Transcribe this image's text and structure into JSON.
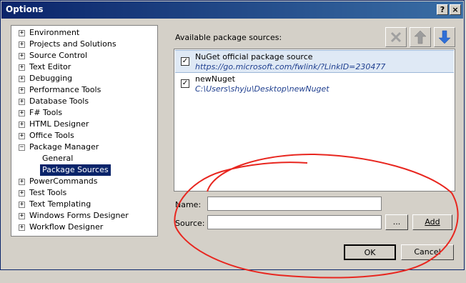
{
  "window": {
    "title": "Options",
    "help_btn": "?",
    "close_btn": "×"
  },
  "tree": {
    "items": [
      {
        "label": "Environment",
        "expander": "+"
      },
      {
        "label": "Projects and Solutions",
        "expander": "+"
      },
      {
        "label": "Source Control",
        "expander": "+"
      },
      {
        "label": "Text Editor",
        "expander": "+"
      },
      {
        "label": "Debugging",
        "expander": "+"
      },
      {
        "label": "Performance Tools",
        "expander": "+"
      },
      {
        "label": "Database Tools",
        "expander": "+"
      },
      {
        "label": "F# Tools",
        "expander": "+"
      },
      {
        "label": "HTML Designer",
        "expander": "+"
      },
      {
        "label": "Office Tools",
        "expander": "+"
      },
      {
        "label": "Package Manager",
        "expander": "−"
      },
      {
        "label": "General"
      },
      {
        "label": "Package Sources"
      },
      {
        "label": "PowerCommands",
        "expander": "+"
      },
      {
        "label": "Test Tools",
        "expander": "+"
      },
      {
        "label": "Text Templating",
        "expander": "+"
      },
      {
        "label": "Windows Forms Designer",
        "expander": "+"
      },
      {
        "label": "Workflow Designer",
        "expander": "+"
      }
    ]
  },
  "panel": {
    "available_label": "Available package sources:",
    "sources": [
      {
        "name": "NuGet official package source",
        "path": "https://go.microsoft.com/fwlink/?LinkID=230477",
        "checked": "✓"
      },
      {
        "name": "newNuget",
        "path": "C:\\Users\\shyju\\Desktop\\newNuget",
        "checked": "✓"
      }
    ],
    "name_label": "Name:",
    "source_label": "Source:",
    "name_value": "",
    "source_value": "",
    "browse_label": "...",
    "add_label": "Add"
  },
  "footer": {
    "ok_label": "OK",
    "cancel_label": "Cancel"
  },
  "colors": {
    "annotation": "#e8261f",
    "up_arrow": "#9c9c9c",
    "down_arrow": "#2f6fd6"
  }
}
